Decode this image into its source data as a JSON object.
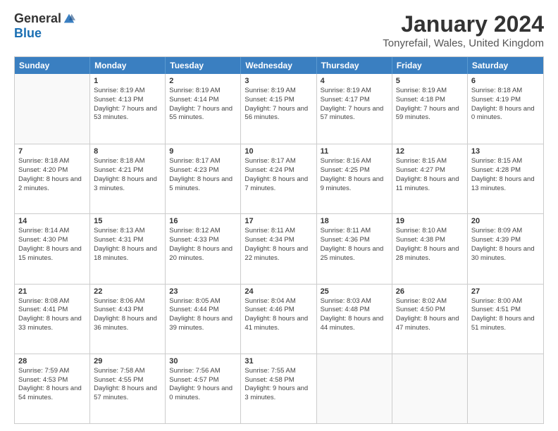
{
  "logo": {
    "general": "General",
    "blue": "Blue"
  },
  "title": "January 2024",
  "subtitle": "Tonyrefail, Wales, United Kingdom",
  "header_days": [
    "Sunday",
    "Monday",
    "Tuesday",
    "Wednesday",
    "Thursday",
    "Friday",
    "Saturday"
  ],
  "weeks": [
    [
      {
        "day": "",
        "sunrise": "",
        "sunset": "",
        "daylight": ""
      },
      {
        "day": "1",
        "sunrise": "Sunrise: 8:19 AM",
        "sunset": "Sunset: 4:13 PM",
        "daylight": "Daylight: 7 hours and 53 minutes."
      },
      {
        "day": "2",
        "sunrise": "Sunrise: 8:19 AM",
        "sunset": "Sunset: 4:14 PM",
        "daylight": "Daylight: 7 hours and 55 minutes."
      },
      {
        "day": "3",
        "sunrise": "Sunrise: 8:19 AM",
        "sunset": "Sunset: 4:15 PM",
        "daylight": "Daylight: 7 hours and 56 minutes."
      },
      {
        "day": "4",
        "sunrise": "Sunrise: 8:19 AM",
        "sunset": "Sunset: 4:17 PM",
        "daylight": "Daylight: 7 hours and 57 minutes."
      },
      {
        "day": "5",
        "sunrise": "Sunrise: 8:19 AM",
        "sunset": "Sunset: 4:18 PM",
        "daylight": "Daylight: 7 hours and 59 minutes."
      },
      {
        "day": "6",
        "sunrise": "Sunrise: 8:18 AM",
        "sunset": "Sunset: 4:19 PM",
        "daylight": "Daylight: 8 hours and 0 minutes."
      }
    ],
    [
      {
        "day": "7",
        "sunrise": "Sunrise: 8:18 AM",
        "sunset": "Sunset: 4:20 PM",
        "daylight": "Daylight: 8 hours and 2 minutes."
      },
      {
        "day": "8",
        "sunrise": "Sunrise: 8:18 AM",
        "sunset": "Sunset: 4:21 PM",
        "daylight": "Daylight: 8 hours and 3 minutes."
      },
      {
        "day": "9",
        "sunrise": "Sunrise: 8:17 AM",
        "sunset": "Sunset: 4:23 PM",
        "daylight": "Daylight: 8 hours and 5 minutes."
      },
      {
        "day": "10",
        "sunrise": "Sunrise: 8:17 AM",
        "sunset": "Sunset: 4:24 PM",
        "daylight": "Daylight: 8 hours and 7 minutes."
      },
      {
        "day": "11",
        "sunrise": "Sunrise: 8:16 AM",
        "sunset": "Sunset: 4:25 PM",
        "daylight": "Daylight: 8 hours and 9 minutes."
      },
      {
        "day": "12",
        "sunrise": "Sunrise: 8:15 AM",
        "sunset": "Sunset: 4:27 PM",
        "daylight": "Daylight: 8 hours and 11 minutes."
      },
      {
        "day": "13",
        "sunrise": "Sunrise: 8:15 AM",
        "sunset": "Sunset: 4:28 PM",
        "daylight": "Daylight: 8 hours and 13 minutes."
      }
    ],
    [
      {
        "day": "14",
        "sunrise": "Sunrise: 8:14 AM",
        "sunset": "Sunset: 4:30 PM",
        "daylight": "Daylight: 8 hours and 15 minutes."
      },
      {
        "day": "15",
        "sunrise": "Sunrise: 8:13 AM",
        "sunset": "Sunset: 4:31 PM",
        "daylight": "Daylight: 8 hours and 18 minutes."
      },
      {
        "day": "16",
        "sunrise": "Sunrise: 8:12 AM",
        "sunset": "Sunset: 4:33 PM",
        "daylight": "Daylight: 8 hours and 20 minutes."
      },
      {
        "day": "17",
        "sunrise": "Sunrise: 8:11 AM",
        "sunset": "Sunset: 4:34 PM",
        "daylight": "Daylight: 8 hours and 22 minutes."
      },
      {
        "day": "18",
        "sunrise": "Sunrise: 8:11 AM",
        "sunset": "Sunset: 4:36 PM",
        "daylight": "Daylight: 8 hours and 25 minutes."
      },
      {
        "day": "19",
        "sunrise": "Sunrise: 8:10 AM",
        "sunset": "Sunset: 4:38 PM",
        "daylight": "Daylight: 8 hours and 28 minutes."
      },
      {
        "day": "20",
        "sunrise": "Sunrise: 8:09 AM",
        "sunset": "Sunset: 4:39 PM",
        "daylight": "Daylight: 8 hours and 30 minutes."
      }
    ],
    [
      {
        "day": "21",
        "sunrise": "Sunrise: 8:08 AM",
        "sunset": "Sunset: 4:41 PM",
        "daylight": "Daylight: 8 hours and 33 minutes."
      },
      {
        "day": "22",
        "sunrise": "Sunrise: 8:06 AM",
        "sunset": "Sunset: 4:43 PM",
        "daylight": "Daylight: 8 hours and 36 minutes."
      },
      {
        "day": "23",
        "sunrise": "Sunrise: 8:05 AM",
        "sunset": "Sunset: 4:44 PM",
        "daylight": "Daylight: 8 hours and 39 minutes."
      },
      {
        "day": "24",
        "sunrise": "Sunrise: 8:04 AM",
        "sunset": "Sunset: 4:46 PM",
        "daylight": "Daylight: 8 hours and 41 minutes."
      },
      {
        "day": "25",
        "sunrise": "Sunrise: 8:03 AM",
        "sunset": "Sunset: 4:48 PM",
        "daylight": "Daylight: 8 hours and 44 minutes."
      },
      {
        "day": "26",
        "sunrise": "Sunrise: 8:02 AM",
        "sunset": "Sunset: 4:50 PM",
        "daylight": "Daylight: 8 hours and 47 minutes."
      },
      {
        "day": "27",
        "sunrise": "Sunrise: 8:00 AM",
        "sunset": "Sunset: 4:51 PM",
        "daylight": "Daylight: 8 hours and 51 minutes."
      }
    ],
    [
      {
        "day": "28",
        "sunrise": "Sunrise: 7:59 AM",
        "sunset": "Sunset: 4:53 PM",
        "daylight": "Daylight: 8 hours and 54 minutes."
      },
      {
        "day": "29",
        "sunrise": "Sunrise: 7:58 AM",
        "sunset": "Sunset: 4:55 PM",
        "daylight": "Daylight: 8 hours and 57 minutes."
      },
      {
        "day": "30",
        "sunrise": "Sunrise: 7:56 AM",
        "sunset": "Sunset: 4:57 PM",
        "daylight": "Daylight: 9 hours and 0 minutes."
      },
      {
        "day": "31",
        "sunrise": "Sunrise: 7:55 AM",
        "sunset": "Sunset: 4:58 PM",
        "daylight": "Daylight: 9 hours and 3 minutes."
      },
      {
        "day": "",
        "sunrise": "",
        "sunset": "",
        "daylight": ""
      },
      {
        "day": "",
        "sunrise": "",
        "sunset": "",
        "daylight": ""
      },
      {
        "day": "",
        "sunrise": "",
        "sunset": "",
        "daylight": ""
      }
    ]
  ]
}
